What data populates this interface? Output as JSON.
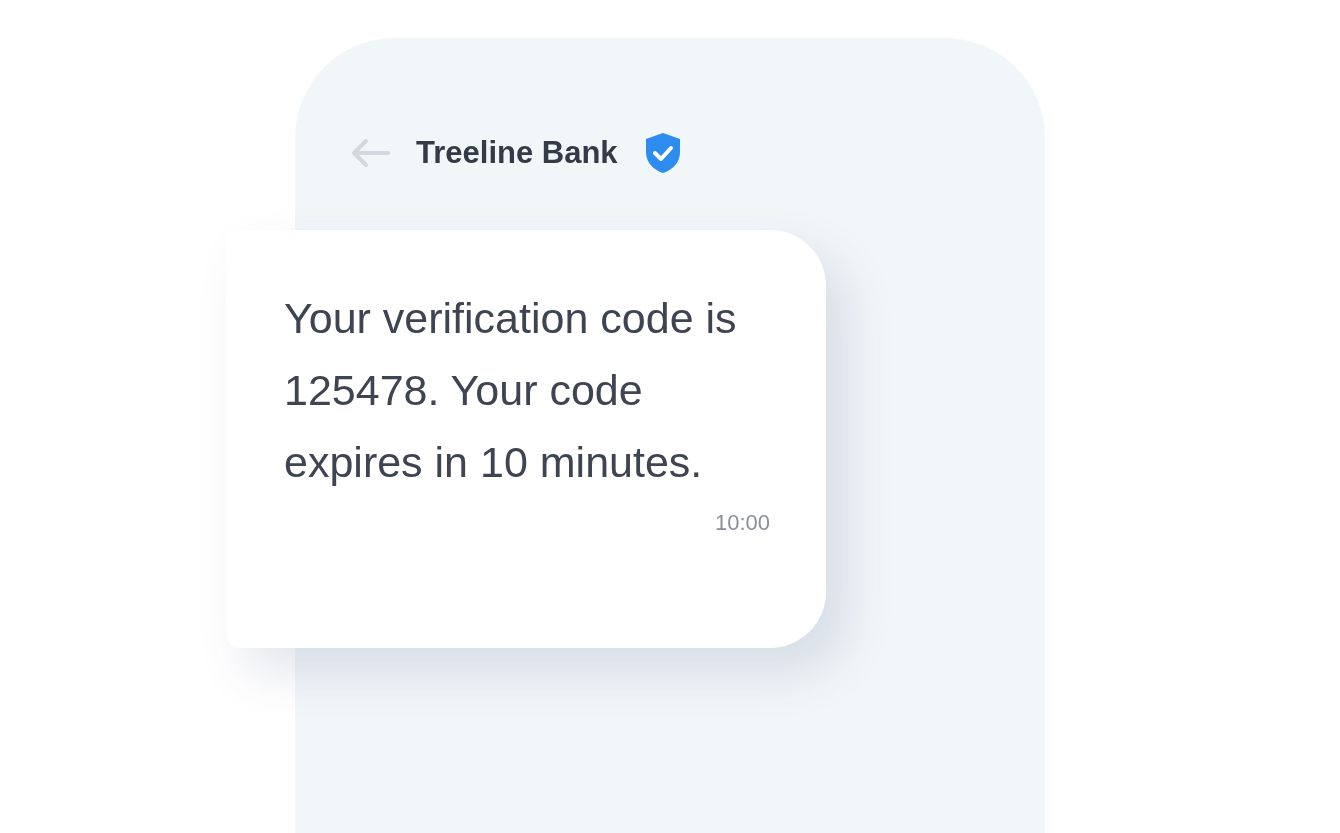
{
  "header": {
    "title": "Treeline Bank",
    "verified": true
  },
  "message": {
    "text": "Your verification code is 125478. Your code expires in 10 minutes.",
    "time": "10:00"
  }
}
